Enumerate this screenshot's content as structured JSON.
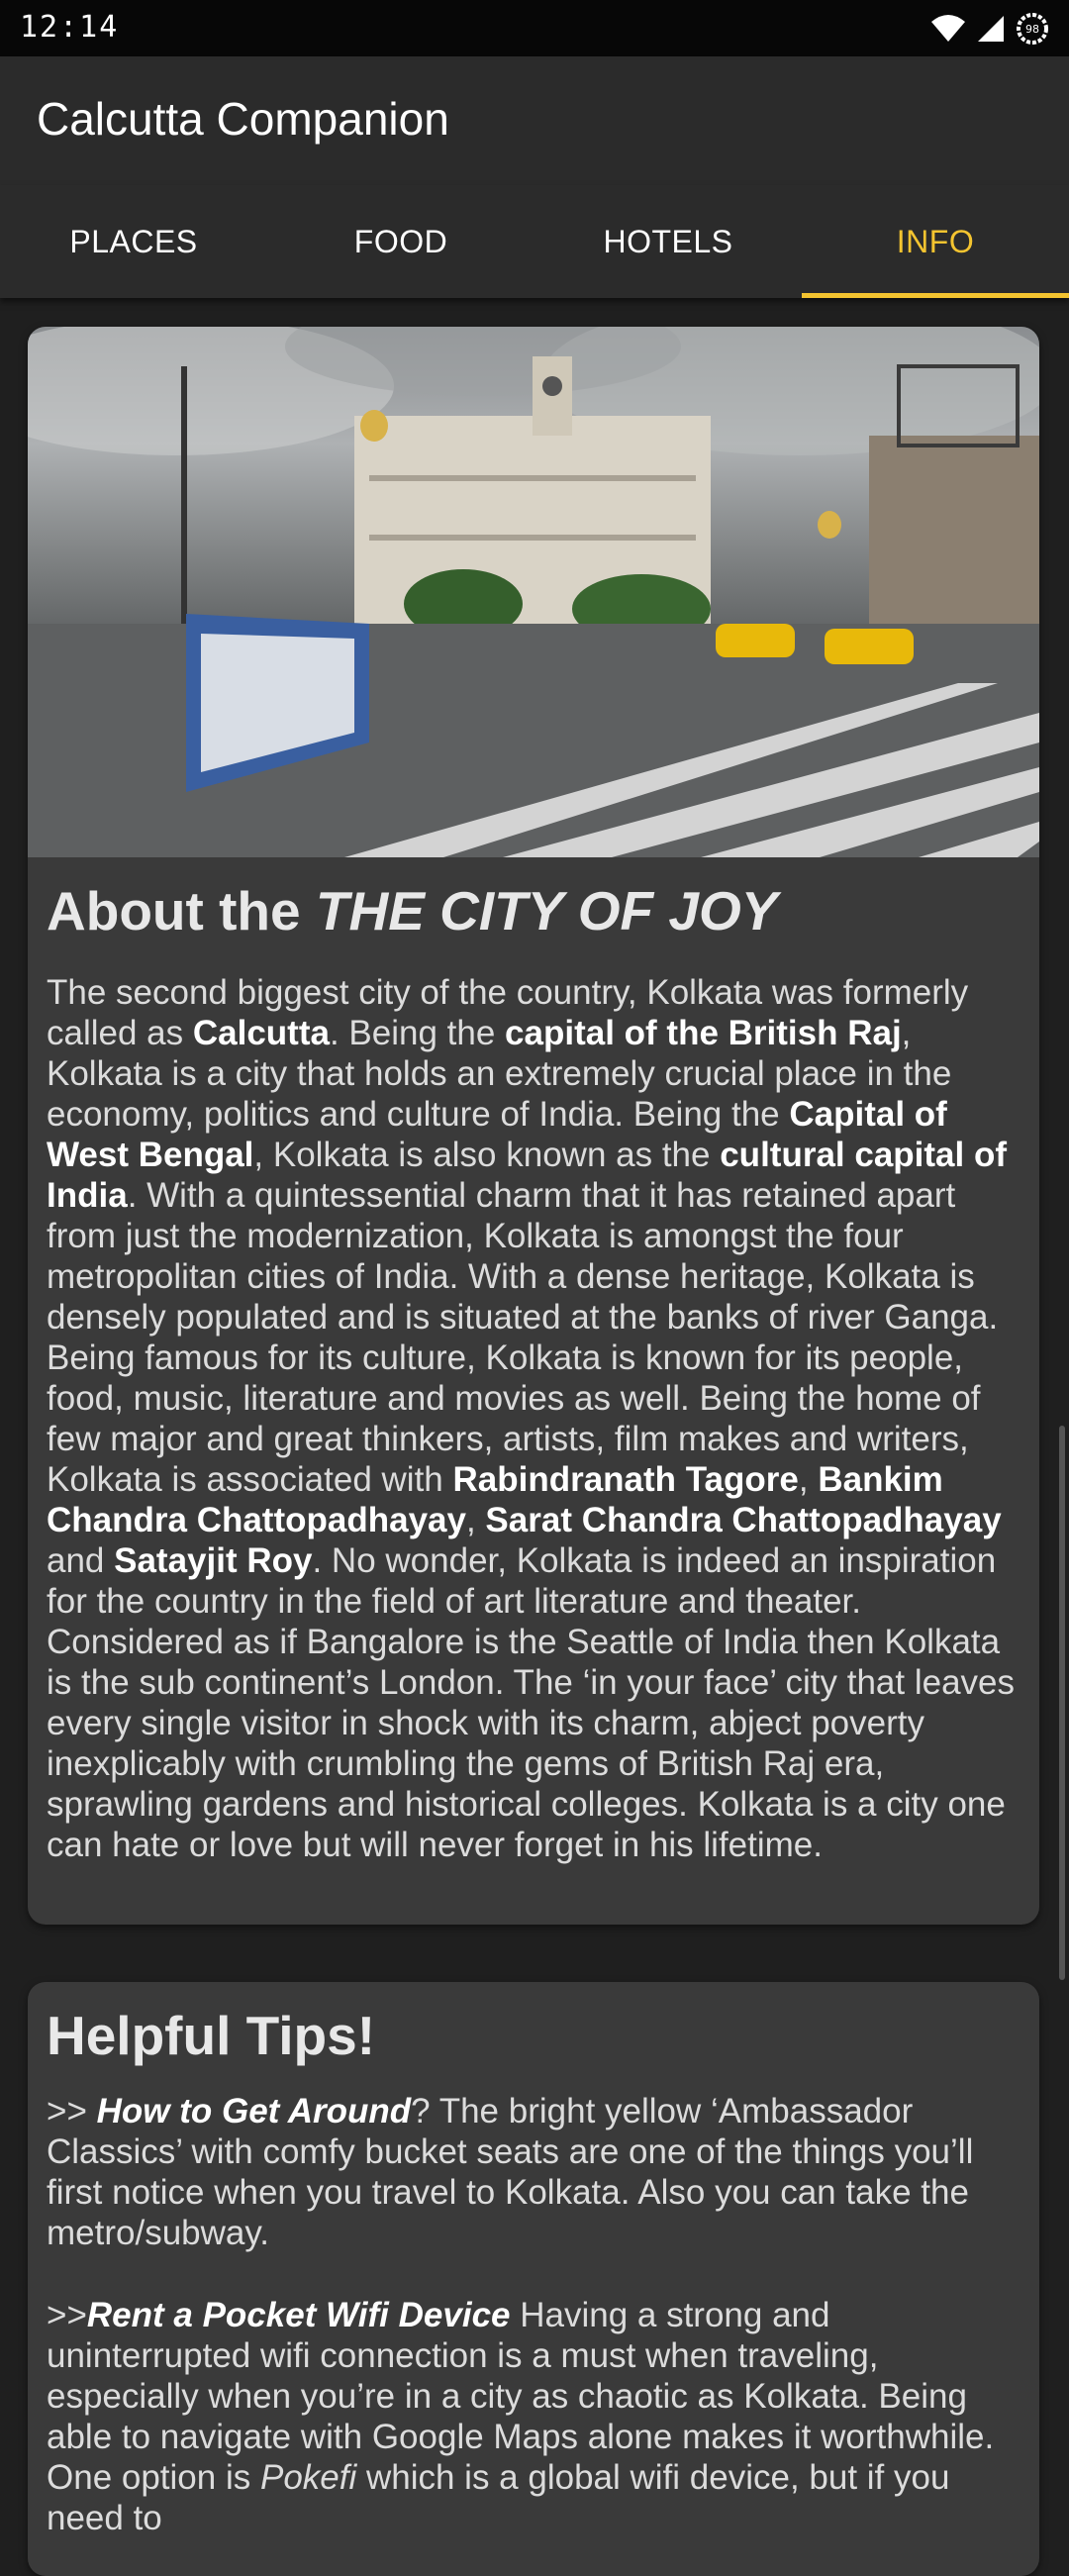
{
  "status": {
    "time": "12:14",
    "battery": "98"
  },
  "app": {
    "title": "Calcutta Companion"
  },
  "tabs": [
    {
      "label": "PLACES",
      "active": false
    },
    {
      "label": "FOOD",
      "active": false
    },
    {
      "label": "HOTELS",
      "active": false
    },
    {
      "label": "INFO",
      "active": true
    }
  ],
  "about": {
    "title_prefix": "About the ",
    "title_emph": "THE CITY OF JOY",
    "image_alt": "Kolkata street with colonial building and yellow Ambassador taxis",
    "p": {
      "t1": "The second biggest city of the country, Kolkata was formerly called as ",
      "b1": "Calcutta",
      "t2": ". Being the ",
      "b2": "capital of the British Raj",
      "t3": ", Kolkata is a city that holds an extremely crucial place in the economy, politics and culture of India. Being the ",
      "b3": "Capital of West Bengal",
      "t4": ", Kolkata is also known as the ",
      "b4": "cultural capital of India",
      "t5": ". With a quintessential charm that it has retained apart from just the modernization, Kolkata is amongst the four metropolitan cities of India. With a dense heritage, Kolkata is densely populated and is situated at the banks of river Ganga. Being famous for its culture, Kolkata is known for its people, food, music, literature and movies as well. Being the home of few major and great thinkers, artists, film makes and writers, Kolkata is associated with ",
      "b5": "Rabindranath Tagore",
      "t6": ", ",
      "b6": "Bankim Chandra Chattopadhayay",
      "t7": ", ",
      "b7": "Sarat Chandra Chattopadhayay",
      "t8": " and ",
      "b8": "Satayjit Roy",
      "t9": ". No wonder, Kolkata is indeed an inspiration for the country in the field of art literature and theater. Considered as if Bangalore is the Seattle of India then Kolkata is the sub continent’s London. The ‘in your face’ city that leaves every single visitor in shock with its charm, abject poverty inexplicably with crumbling the gems of British Raj era, sprawling gardens and historical colleges. Kolkata is a city one can hate or love but will never forget in his lifetime."
    }
  },
  "tips": {
    "title": "Helpful Tips!",
    "tip1": {
      "prefix": ">> ",
      "heading": "How to Get Around",
      "text": "? The bright yellow ‘Ambassador Classics’ with comfy bucket seats are one of the things you’ll first notice when you travel to Kolkata. Also you can take the metro/subway."
    },
    "tip2": {
      "prefix": " >>",
      "heading": "Rent a Pocket Wifi Device",
      "text1": " Having a strong and uninterrupted wifi connection is a must when traveling, especially when you’re in a city as chaotic as Kolkata. Being able to navigate with Google Maps alone makes it worthwhile. One option is ",
      "emph": "Pokefi",
      "text2": " which is a global wifi device, but if you need to"
    }
  }
}
